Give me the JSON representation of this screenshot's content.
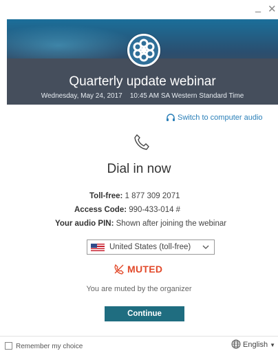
{
  "window": {
    "minimize_glyph": "_",
    "close_glyph": "✕"
  },
  "header": {
    "title": "Quarterly update webinar",
    "datetime": "Wednesday, May 24, 2017    10:45 AM SA Western Standard Time",
    "logo_icon": "gotowebinar-flower-logo"
  },
  "audio": {
    "switch_label": "Switch to computer audio",
    "switch_icon": "headset-icon"
  },
  "dial": {
    "icon": "phone-icon",
    "title": "Dial in now",
    "toll_free_label": "Toll-free:",
    "toll_free_value": "1 877 309 2071",
    "access_code_label": "Access Code:",
    "access_code_value": "990-433-014 #",
    "pin_label": "Your audio PIN:",
    "pin_value": "Shown after joining the webinar"
  },
  "country_select": {
    "selected": "United States (toll-free)",
    "flag": "us-flag-icon"
  },
  "mute": {
    "status": "MUTED",
    "note": "You are muted by the organizer",
    "color": "#e2492a"
  },
  "actions": {
    "continue_label": "Continue"
  },
  "footer": {
    "remember_label": "Remember my choice",
    "remember_checked": false,
    "language_label": "English"
  },
  "colors": {
    "accent": "#2a7fb8",
    "button": "#1f6d80",
    "header_dark": "#454e5c"
  }
}
